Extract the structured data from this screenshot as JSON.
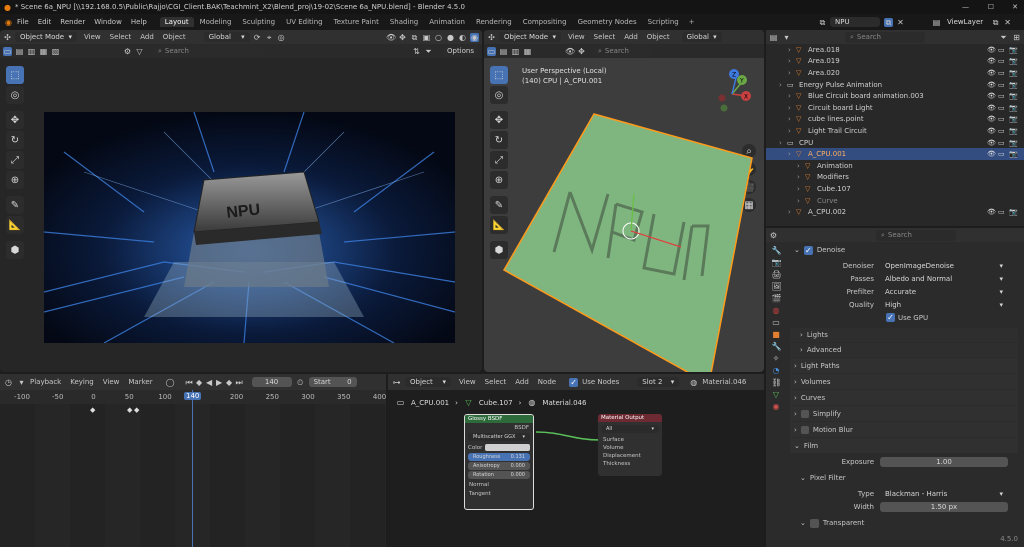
{
  "window": {
    "title": "* Scene 6a_NPU [\\\\192.168.0.5\\Public\\Rajjo\\CGI_Client.BAK\\Teachmint_X2\\Blend_proj\\19-02\\Scene 6a_NPU.blend] - Blender 4.5.0"
  },
  "topbar": {
    "menus": [
      "File",
      "Edit",
      "Render",
      "Window",
      "Help"
    ],
    "workspaces": [
      "Layout",
      "Modeling",
      "Sculpting",
      "UV Editing",
      "Texture Paint",
      "Shading",
      "Animation",
      "Rendering",
      "Compositing",
      "Geometry Nodes",
      "Scripting"
    ],
    "active_workspace": "Layout",
    "add_tab": "+",
    "scene_name": "NPU",
    "view_layer": "ViewLayer"
  },
  "viewport_left": {
    "mode": "Object Mode",
    "menus": [
      "View",
      "Select",
      "Add",
      "Object"
    ],
    "orientation": "Global",
    "search_placeholder": "Search",
    "options": "Options",
    "render_text": "NPU"
  },
  "viewport_right": {
    "mode": "Object Mode",
    "menus": [
      "View",
      "Select",
      "Add",
      "Object"
    ],
    "orientation": "Global",
    "search_placeholder": "Search",
    "overlay_line1": "User Perspective (Local)",
    "overlay_line2": "(140) CPU | A_CPU.001",
    "gizmo": {
      "x": "X",
      "y": "Y",
      "z": "Z"
    }
  },
  "outliner": {
    "search_placeholder": "Search",
    "items": [
      {
        "label": "Area.018",
        "indent": 2
      },
      {
        "label": "Area.019",
        "indent": 2
      },
      {
        "label": "Area.020",
        "indent": 2
      },
      {
        "label": "Energy Pulse Animation",
        "indent": 1
      },
      {
        "label": "Blue Circuit board animation.003",
        "indent": 2
      },
      {
        "label": "Circuit board Light",
        "indent": 2
      },
      {
        "label": "cube lines.point",
        "indent": 2
      },
      {
        "label": "Light Trail Circuit",
        "indent": 2
      },
      {
        "label": "CPU",
        "indent": 1
      },
      {
        "label": "A_CPU.001",
        "indent": 2,
        "selected": true
      },
      {
        "label": "Animation",
        "indent": 3
      },
      {
        "label": "Modifiers",
        "indent": 3
      },
      {
        "label": "Cube.107",
        "indent": 3
      },
      {
        "label": "Curve",
        "indent": 3,
        "dim": true
      },
      {
        "label": "A_CPU.002",
        "indent": 2
      }
    ]
  },
  "properties": {
    "search_placeholder": "Search",
    "denoise": {
      "label": "Denoise",
      "denoiser_label": "Denoiser",
      "denoiser": "OpenImageDenoise",
      "passes_label": "Passes",
      "passes": "Albedo and Normal",
      "prefilter_label": "Prefilter",
      "prefilter": "Accurate",
      "quality_label": "Quality",
      "quality": "High",
      "use_gpu": "Use GPU"
    },
    "sub_panels": [
      "Lights",
      "Advanced"
    ],
    "panels": [
      "Light Paths",
      "Volumes",
      "Curves",
      "Simplify",
      "Motion Blur"
    ],
    "film": {
      "label": "Film",
      "exposure_label": "Exposure",
      "exposure": "1.00",
      "pixel_filter": "Pixel Filter",
      "type_label": "Type",
      "type": "Blackman - Harris",
      "width_label": "Width",
      "width": "1.50 px",
      "transparent": "Transparent"
    }
  },
  "timeline": {
    "menus": [
      "Playback",
      "Keying",
      "View",
      "Marker"
    ],
    "current_frame": "140",
    "start_label": "Start",
    "start": "0",
    "ruler": [
      "-100",
      "-50",
      "0",
      "50",
      "100",
      "140",
      "200",
      "250",
      "300",
      "350",
      "400"
    ]
  },
  "node_editor": {
    "type": "Object",
    "menus": [
      "View",
      "Select",
      "Add",
      "Node"
    ],
    "use_nodes": "Use Nodes",
    "slot": "Slot 2",
    "material": "Material.046",
    "breadcrumb": [
      "A_CPU.001",
      "Cube.107",
      "Material.046"
    ],
    "bsdf": {
      "title": "Glossy BSDF",
      "output": "BSDF",
      "distribution": "Multiscatter GGX",
      "color": "Color",
      "roughness_label": "Roughness",
      "roughness": "0.131",
      "anisotropy_label": "Anisotropy",
      "anisotropy": "0.000",
      "rotation_label": "Rotation",
      "rotation": "0.000",
      "normal": "Normal",
      "tangent": "Tangent"
    },
    "output": {
      "title": "Material Output",
      "target": "All",
      "surface": "Surface",
      "volume": "Volume",
      "displacement": "Displacement",
      "thickness": "Thickness"
    }
  },
  "status": {
    "version": "4.5.0"
  },
  "colors": {
    "accent": "#4772b3",
    "selected_row": "#334d80",
    "plane": "#7fb57f",
    "output_header": "#6e2a33",
    "bsdf_header": "#2d6b3a"
  }
}
